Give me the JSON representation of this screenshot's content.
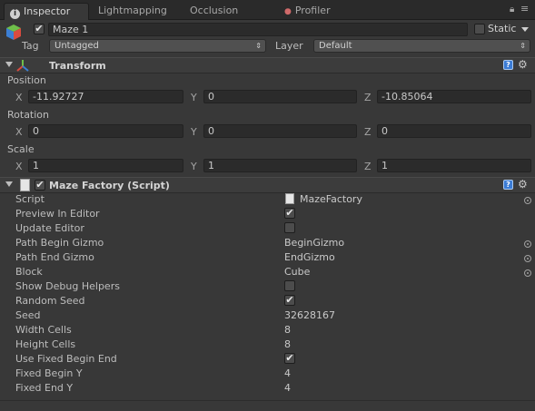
{
  "tabs": [
    {
      "label": "Inspector",
      "icon": "info-icon"
    },
    {
      "label": "Lightmapping"
    },
    {
      "label": "Occlusion"
    },
    {
      "label": "Profiler",
      "icon": "profiler-icon"
    }
  ],
  "object": {
    "name": "Maze 1",
    "active": true,
    "static_label": "Static",
    "tag_label": "Tag",
    "tag_value": "Untagged",
    "layer_label": "Layer",
    "layer_value": "Default"
  },
  "transform": {
    "title": "Transform",
    "position_label": "Position",
    "rotation_label": "Rotation",
    "scale_label": "Scale",
    "axis_x": "X",
    "axis_y": "Y",
    "axis_z": "Z",
    "position": {
      "x": "-11.92727",
      "y": "0",
      "z": "-10.85064"
    },
    "rotation": {
      "x": "0",
      "y": "0",
      "z": "0"
    },
    "scale": {
      "x": "1",
      "y": "1",
      "z": "1"
    }
  },
  "maze_factory": {
    "title": "Maze Factory (Script)",
    "enabled": true,
    "properties": [
      {
        "label": "Script",
        "value": "MazeFactory"
      },
      {
        "label": "Preview In Editor",
        "value": "✔"
      },
      {
        "label": "Update Editor",
        "value": ""
      },
      {
        "label": "Path Begin Gizmo",
        "value": "BeginGizmo"
      },
      {
        "label": "Path End Gizmo",
        "value": "EndGizmo"
      },
      {
        "label": "Block",
        "value": "Cube"
      },
      {
        "label": "Show Debug Helpers",
        "value": ""
      },
      {
        "label": "Random Seed",
        "value": "✔"
      },
      {
        "label": "Seed",
        "value": "32628167"
      },
      {
        "label": "Width Cells",
        "value": "8"
      },
      {
        "label": "Height Cells",
        "value": "8"
      },
      {
        "label": "Use Fixed Begin End",
        "value": "✔"
      },
      {
        "label": "Fixed Begin Y",
        "value": "4"
      },
      {
        "label": "Fixed End Y",
        "value": "4"
      }
    ]
  },
  "colors": {
    "background": "#383838",
    "tabbar": "#2a2a2a",
    "field": "#2b2b2b",
    "help_blue": "#3a7bd5"
  }
}
